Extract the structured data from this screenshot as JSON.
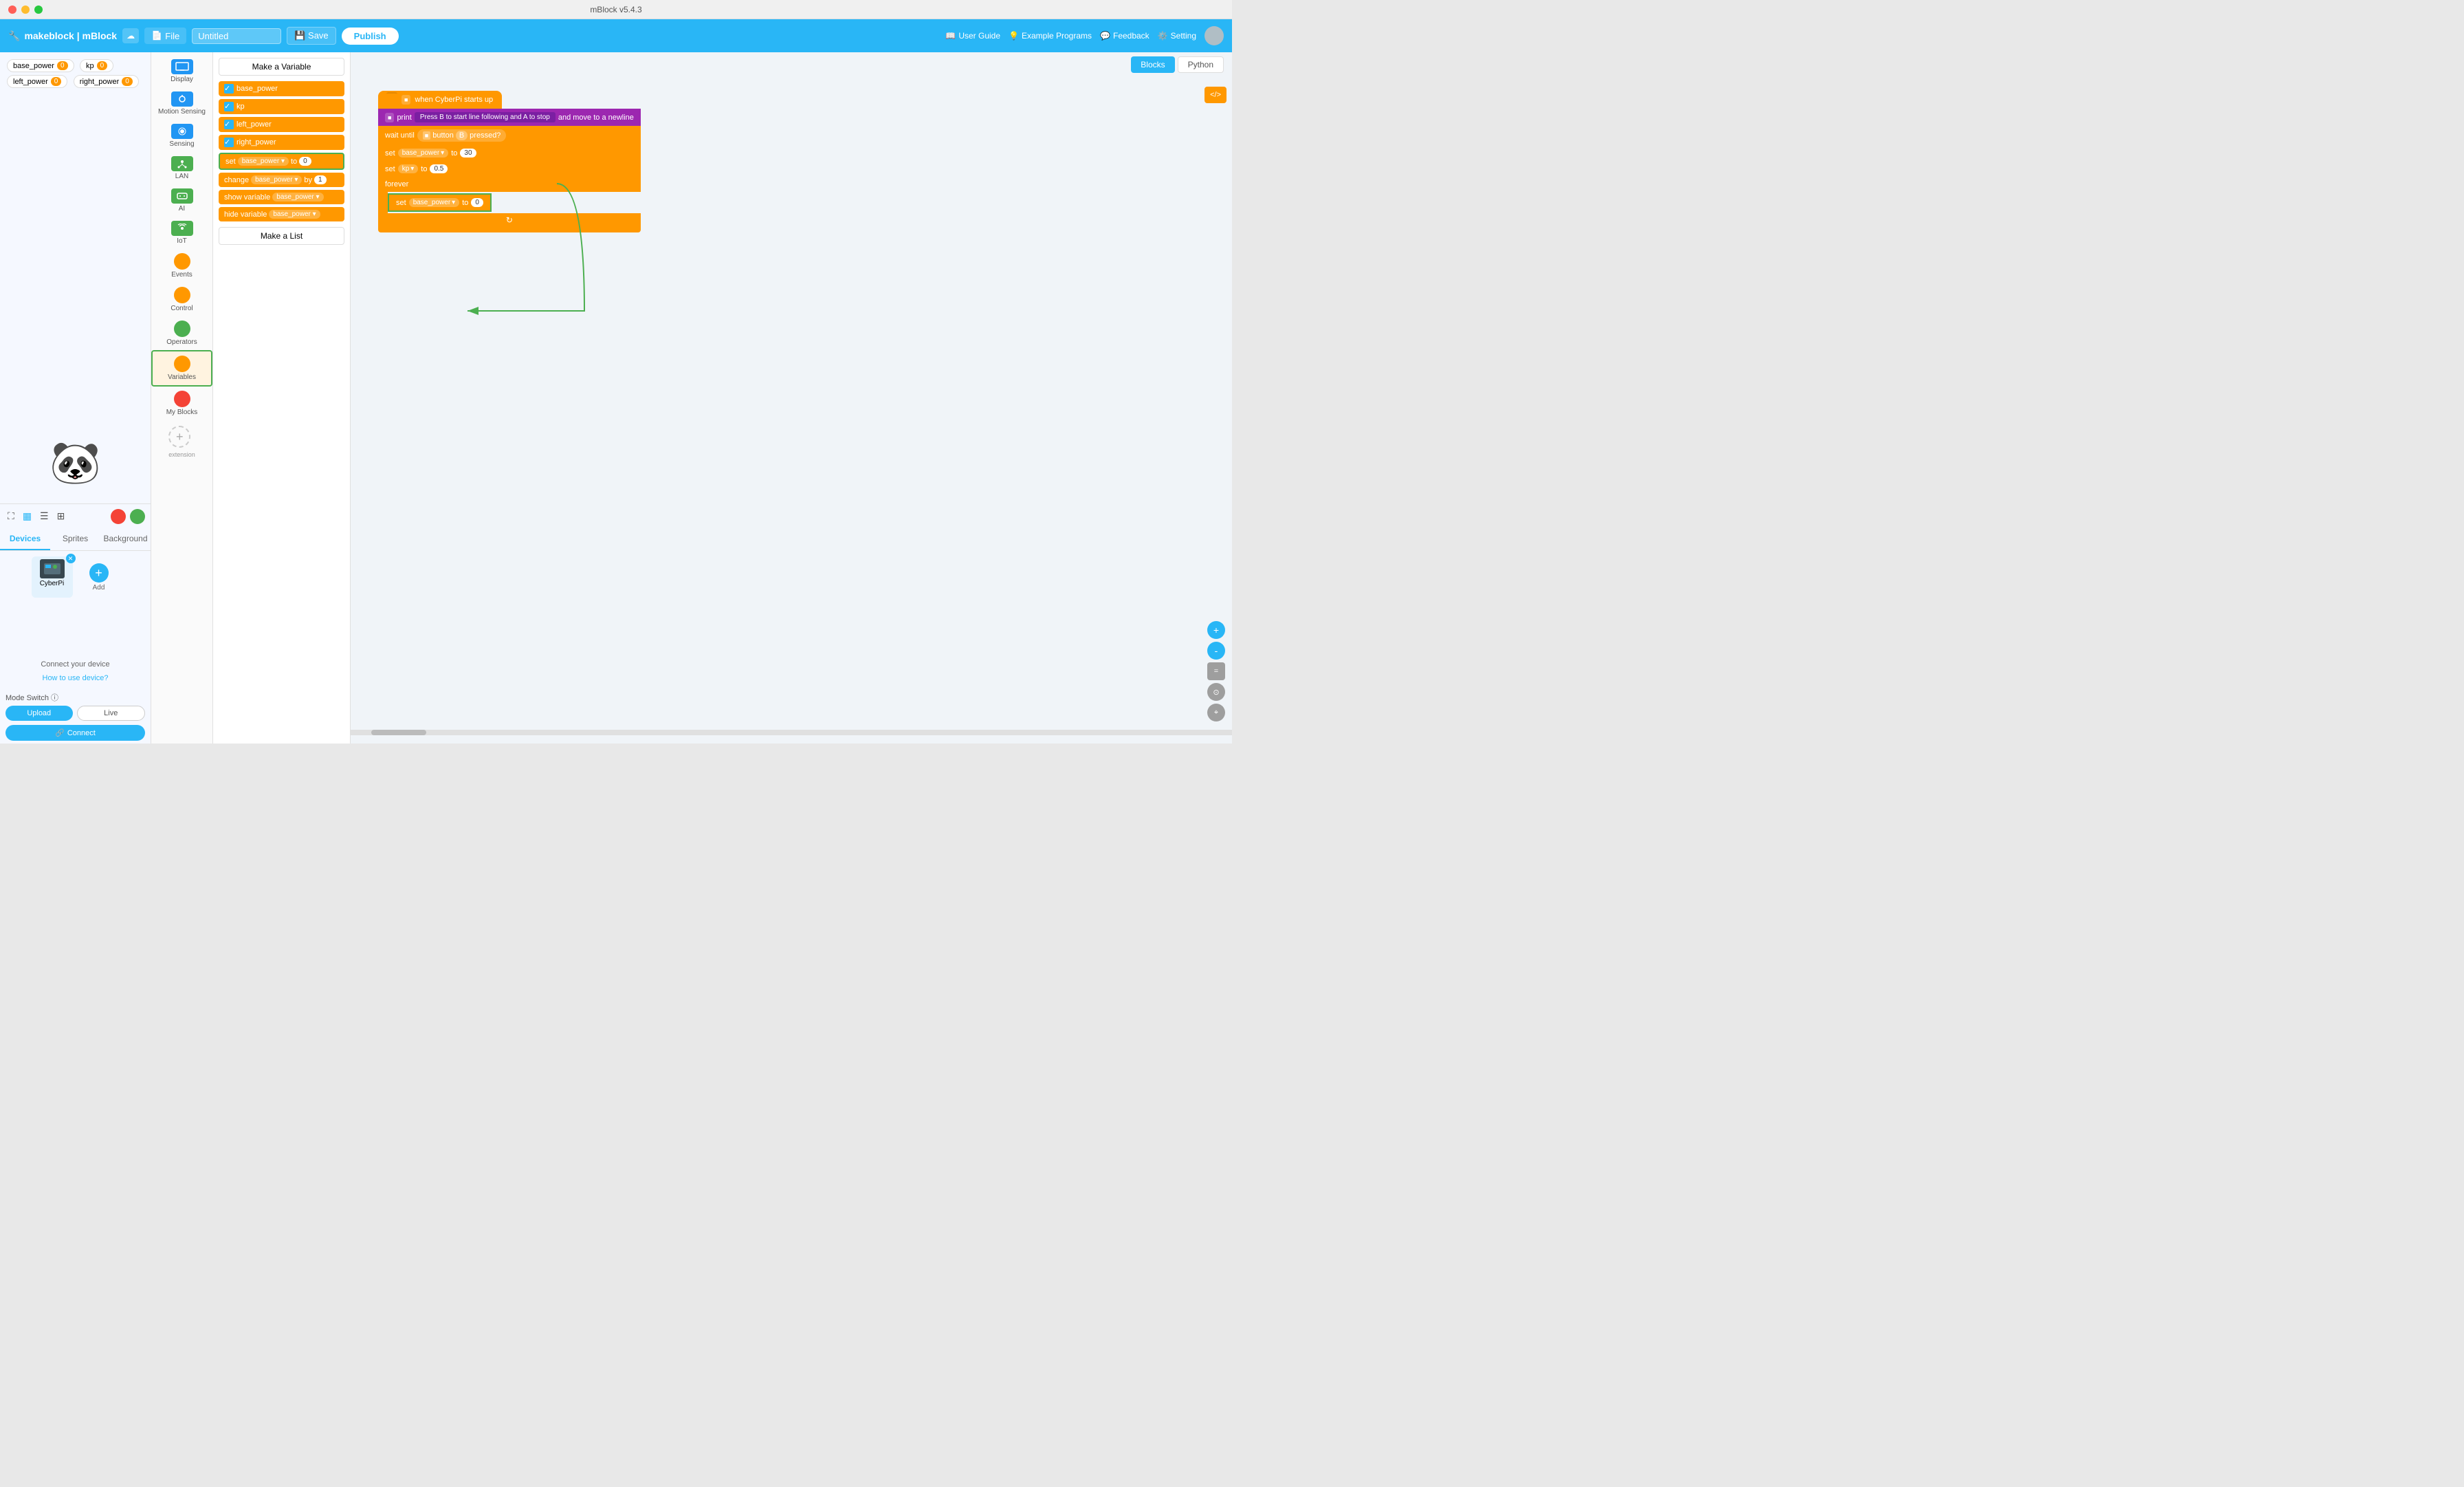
{
  "window": {
    "title": "mBlock v5.4.3"
  },
  "header": {
    "logo": "makeblock | mBlock",
    "file_label": "File",
    "title_placeholder": "Untitled",
    "title_value": "Untitled",
    "save_label": "Save",
    "publish_label": "Publish",
    "user_guide_label": "User Guide",
    "example_programs_label": "Example Programs",
    "feedback_label": "Feedback",
    "setting_label": "Setting"
  },
  "variables": [
    {
      "name": "base_power",
      "value": "0"
    },
    {
      "name": "kp",
      "value": "0"
    },
    {
      "name": "left_power",
      "value": "0"
    },
    {
      "name": "right_power",
      "value": "0"
    }
  ],
  "view_controls": {
    "stop_title": "Stop",
    "go_title": "Go"
  },
  "tabs": {
    "devices_label": "Devices",
    "sprites_label": "Sprites",
    "background_label": "Background"
  },
  "device": {
    "name": "CyberPi",
    "connect_text": "Connect your device",
    "how_to_label": "How to use device?",
    "mode_switch_label": "Mode Switch",
    "upload_label": "Upload",
    "live_label": "Live",
    "connect_label": "Connect"
  },
  "block_categories": [
    {
      "label": "Display",
      "color": "#2196f3",
      "icon": "display"
    },
    {
      "label": "Motion Sensing",
      "color": "#2196f3",
      "icon": "motion"
    },
    {
      "label": "Sensing",
      "color": "#2196f3",
      "icon": "sensing"
    },
    {
      "label": "LAN",
      "color": "#4caf50",
      "icon": "lan"
    },
    {
      "label": "AI",
      "color": "#4caf50",
      "icon": "ai"
    },
    {
      "label": "IoT",
      "color": "#4caf50",
      "icon": "iot"
    },
    {
      "label": "Events",
      "color": "#ff9800",
      "icon": "events"
    },
    {
      "label": "Control",
      "color": "#ff9800",
      "icon": "control"
    },
    {
      "label": "Operators",
      "color": "#4caf50",
      "icon": "operators"
    },
    {
      "label": "Variables",
      "color": "#ff9800",
      "icon": "variables",
      "active": true
    },
    {
      "label": "My Blocks",
      "color": "#f44336",
      "icon": "myblocks"
    }
  ],
  "blocks_panel": {
    "make_variable_label": "Make a Variable",
    "make_list_label": "Make a List",
    "variables": [
      "base_power",
      "kp",
      "left_power",
      "right_power"
    ],
    "checked": [
      true,
      true,
      true,
      true
    ],
    "set_label": "set",
    "to_label": "to",
    "change_label": "change",
    "by_label": "by",
    "show_label": "show variable",
    "hide_label": "hide variable"
  },
  "workspace": {
    "tabs": [
      "Blocks",
      "Python"
    ],
    "active_tab": "Blocks"
  },
  "code_blocks": {
    "hat_label": "when CyberPi starts up",
    "print_label": "print",
    "print_text": "Press B to start line following and A to stop",
    "print_suffix": "and move to a newline",
    "wait_label": "wait until",
    "button_label": "button",
    "button_var": "B",
    "pressed_label": "pressed?",
    "set1_label": "set",
    "set1_var": "base_power",
    "set1_to": "to",
    "set1_val": "30",
    "set2_label": "set",
    "set2_var": "kp",
    "set2_to": "to",
    "set2_val": "0.5",
    "forever_label": "forever",
    "set3_label": "set",
    "set3_var": "base_power",
    "set3_to": "to",
    "set3_val": "0"
  },
  "zoom_controls": {
    "zoom_in_label": "+",
    "zoom_out_label": "-",
    "reset_label": "="
  }
}
